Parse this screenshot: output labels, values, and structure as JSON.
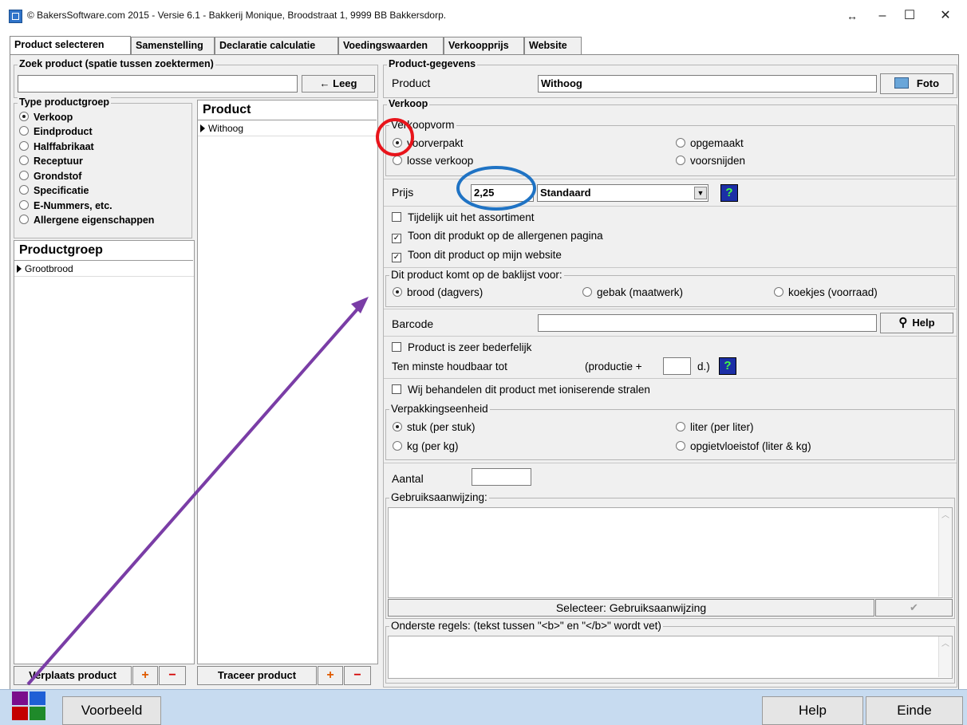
{
  "window": {
    "title": "© BakersSoftware.com 2015 - Versie 6.1 - Bakkerij Monique, Broodstraat 1, 9999 BB Bakkersdorp.",
    "controls": {
      "resize": "↔",
      "minimize": "–",
      "maximize": "☐",
      "close": "✕"
    }
  },
  "tabs": [
    "Product selecteren",
    "Samenstelling",
    "Declaratie calculatie",
    "Voedingswaarden",
    "Verkoopprijs",
    "Website"
  ],
  "left": {
    "search_label": "Zoek product (spatie tussen zoektermen)",
    "search_value": "",
    "clear_button": "← Leeg",
    "type_group": {
      "label": "Type productgroep",
      "options": [
        "Verkoop",
        "Eindproduct",
        "Halffabrikaat",
        "Receptuur",
        "Grondstof",
        "Specificatie",
        "E-Nummers, etc.",
        "Allergene eigenschappen"
      ],
      "selected": "Verkoop"
    },
    "productgroep_header": "Productgroep",
    "productgroep_rows": [
      "Grootbrood"
    ],
    "product_header": "Product",
    "product_rows": [
      "Withoog"
    ],
    "move_button": "Verplaats product",
    "trace_button": "Traceer product",
    "plus": "+",
    "minus": "−"
  },
  "right": {
    "product_gegevens_label": "Product-gegevens",
    "product_label": "Product",
    "product_value": "Withoog",
    "foto_button": "Foto",
    "verkoop_label": "Verkoop",
    "verkoopvorm": {
      "label": "Verkoopvorm",
      "options": [
        "voorverpakt",
        "opgemaakt",
        "losse verkoop",
        "voorsnijden"
      ],
      "selected": "voorverpakt"
    },
    "prijs_label": "Prijs",
    "prijs_value": "2,25",
    "prijs_type": "Standaard",
    "help_q": "?",
    "checks": [
      {
        "label": "Tijdelijk uit het assortiment",
        "checked": false
      },
      {
        "label": "Toon dit produkt op de allergenen pagina",
        "checked": true
      },
      {
        "label": "Toon dit product op mijn website",
        "checked": true
      }
    ],
    "baklijst": {
      "label": "Dit product komt op de baklijst voor:",
      "options": [
        "brood (dagvers)",
        "gebak (maatwerk)",
        "koekjes (voorraad)"
      ],
      "selected": "brood (dagvers)"
    },
    "barcode_label": "Barcode",
    "barcode_value": "",
    "help_button": "Help",
    "bederfelijk": {
      "label": "Product is zeer bederfelijk",
      "checked": false
    },
    "houdbaar_label": "Ten minste houdbaar tot",
    "productie_label": "(productie +",
    "productie_value": "",
    "days_label": "d.)",
    "ioniserend": {
      "label": "Wij behandelen dit product met ioniserende stralen",
      "checked": false
    },
    "verpakking": {
      "label": "Verpakkingseenheid",
      "options": [
        "stuk (per stuk)",
        "liter (per liter)",
        "kg (per kg)",
        "opgietvloeistof (liter & kg)"
      ],
      "selected": "stuk (per stuk)"
    },
    "aantal_label": "Aantal",
    "aantal_value": "",
    "gebruik_label": "Gebruiksaanwijzing:",
    "gebruik_value": "",
    "selecteer_button": "Selecteer: Gebruiksaanwijzing",
    "check_mark": "✔",
    "onderste_label": "Onderste regels: (tekst tussen \"<b>\" en \"</b>\" wordt vet)",
    "onderste_value": ""
  },
  "bottom": {
    "voorbeeld": "Voorbeeld",
    "help": "Help",
    "einde": "Einde",
    "logo_colors": [
      "#7b0d8c",
      "#1f5fd6",
      "#c40000",
      "#1f8a2a"
    ]
  },
  "annotations": {
    "circle_red": "#e8141b",
    "circle_blue": "#1f73c4",
    "arrow_color": "#7a3da6"
  }
}
